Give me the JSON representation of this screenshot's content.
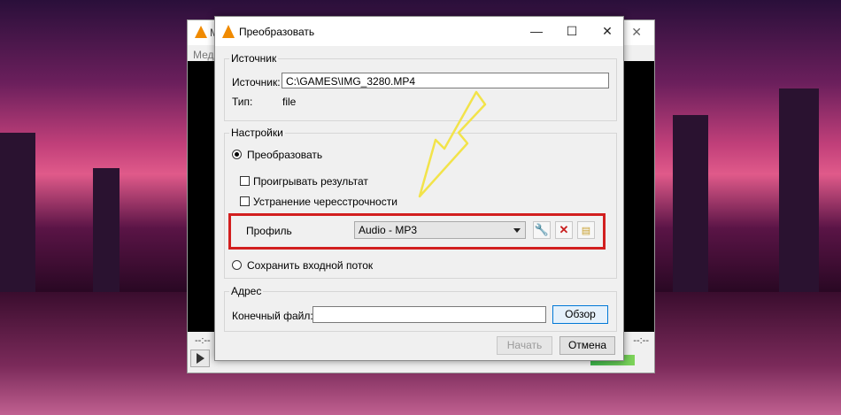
{
  "vlc": {
    "title": "M",
    "menu": "Меди",
    "time_left": "--:--",
    "time_right": "--:--"
  },
  "dialog": {
    "title": "Преобразовать",
    "minimize": "—",
    "maximize": "☐",
    "close": "✕",
    "source": {
      "group_label": "Источник",
      "source_label": "Источник:",
      "source_value": "C:\\GAMES\\IMG_3280.MP4",
      "type_label": "Тип:",
      "type_value": "file"
    },
    "settings": {
      "group_label": "Настройки",
      "convert_label": "Преобразовать",
      "play_result_label": "Проигрывать результат",
      "deinterlace_label": "Устранение чересстрочности",
      "profile_label": "Профиль",
      "profile_value": "Audio - MP3",
      "dump_raw_label": "Сохранить входной поток"
    },
    "destination": {
      "group_label": "Адрес",
      "dest_file_label": "Конечный файл:",
      "dest_file_value": "",
      "browse_button": "Обзор"
    },
    "start_button": "Начать",
    "cancel_button": "Отмена"
  },
  "colors": {
    "highlight_box": "#d21f1f",
    "arrow": "#f2e34a",
    "vlc_cone": "#f08a00"
  }
}
